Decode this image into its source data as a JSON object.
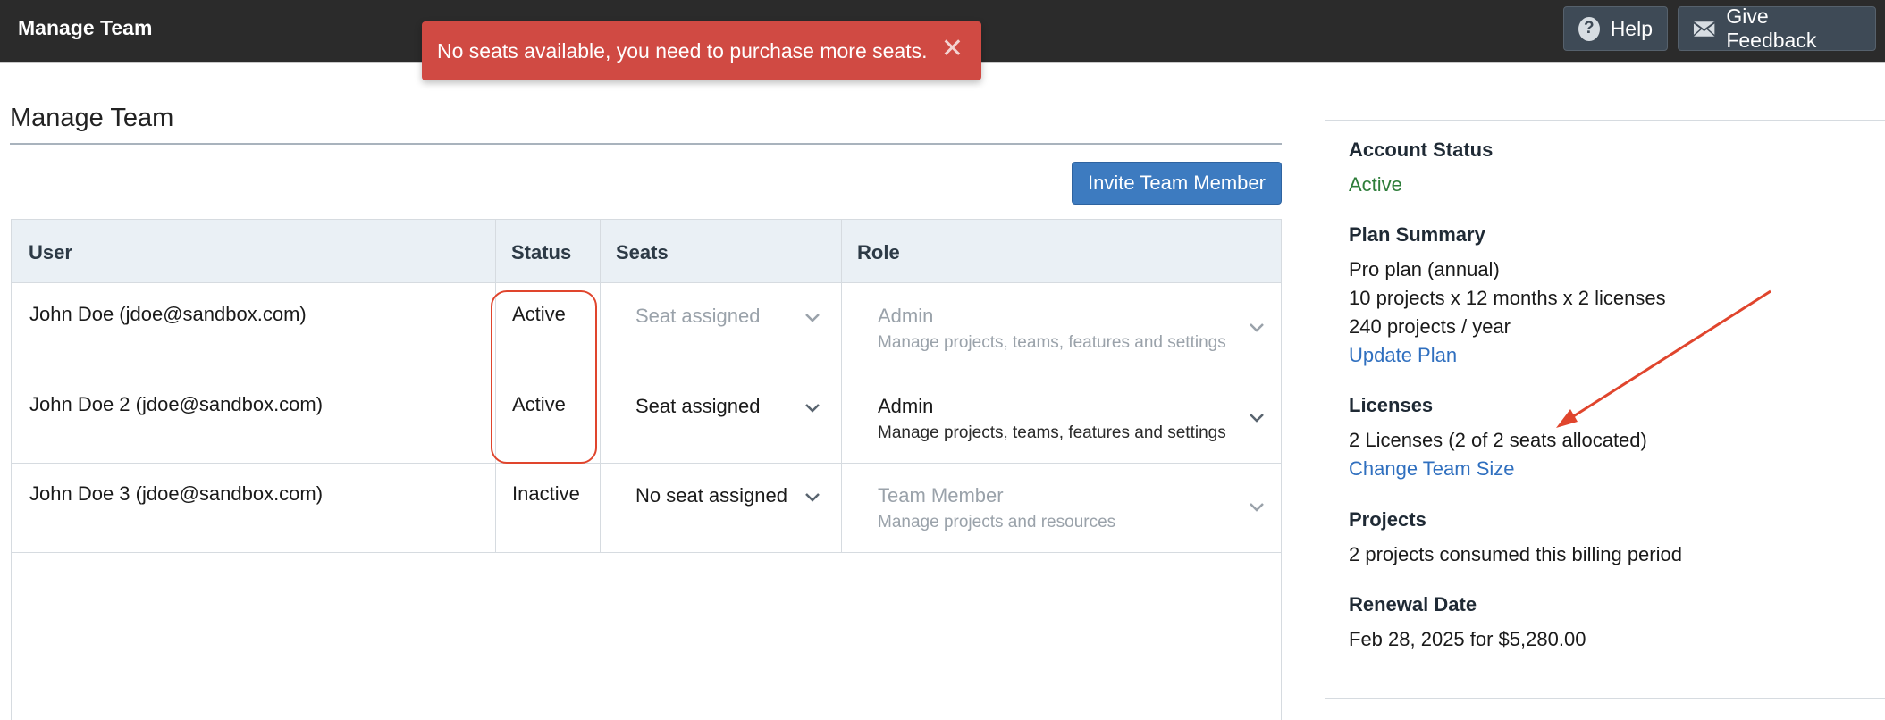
{
  "topbar": {
    "title": "Manage Team",
    "help_label": "Help",
    "help_icon": "question-circle-icon",
    "feedback_label": "Give Feedback",
    "feedback_icon": "mail-icon"
  },
  "toast": {
    "message": "No seats available, you need to purchase more seats.",
    "close": "✕"
  },
  "main": {
    "title": "Manage Team",
    "invite_label": "Invite Team Member"
  },
  "table": {
    "columns": [
      "User",
      "Status",
      "Seats",
      "Role"
    ],
    "rows": [
      {
        "user": "John Doe (jdoe@sandbox.com)",
        "status": "Active",
        "seat": "Seat assigned",
        "role": "Admin",
        "role_desc": "Manage projects, teams, features and settings",
        "disabled": true
      },
      {
        "user": "John Doe 2 (jdoe@sandbox.com)",
        "status": "Active",
        "seat": "Seat assigned",
        "role": "Admin",
        "role_desc": "Manage projects, teams, features and settings",
        "disabled": false
      },
      {
        "user": "John Doe 3 (jdoe@sandbox.com)",
        "status": "Inactive",
        "seat": "No seat assigned",
        "role": "Team Member",
        "role_desc": "Manage projects and resources",
        "disabled": true
      }
    ]
  },
  "panel": {
    "account_status_label": "Account Status",
    "account_status": "Active",
    "plan_summary_label": "Plan Summary",
    "plan_line1": "Pro plan (annual)",
    "plan_line2": "10 projects x 12 months x 2 licenses",
    "plan_line3": "240 projects / year",
    "update_plan": "Update Plan",
    "licenses_label": "Licenses",
    "licenses_text": "2 Licenses (2 of 2 seats allocated)",
    "change_team_size": "Change Team Size",
    "projects_label": "Projects",
    "projects_text": "2 projects consumed this billing period",
    "renewal_label": "Renewal Date",
    "renewal_text": "Feb 28, 2025 for $5,280.00"
  },
  "colors": {
    "topbar": "#2b2b2b",
    "toast": "#d04a43",
    "primary": "#3d7bc0",
    "link": "#2f6fbf",
    "active_green": "#2e7d3a",
    "annotation_red": "#e0452d"
  }
}
